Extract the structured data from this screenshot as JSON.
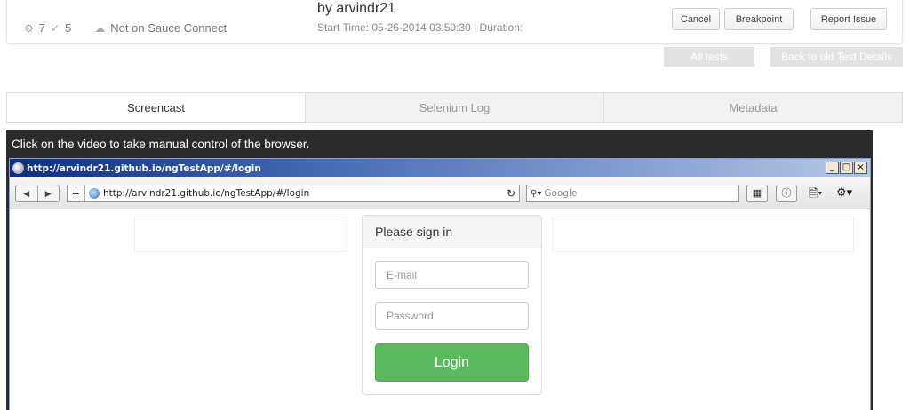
{
  "header": {
    "stats": {
      "builds_count": "7",
      "checks_count": "5",
      "tunnel_status": "Not on Sauce Connect"
    },
    "title": "by arvindr21",
    "start_time": "Start Time: 05-26-2014 03:59:30 | Duration:",
    "buttons": {
      "cancel": "Cancel",
      "breakpoint": "Breakpoint",
      "report": "Report Issue"
    },
    "links": {
      "all_tests": "All tests",
      "old_details": "Back to old Test Details"
    }
  },
  "tabs": [
    "Screencast",
    "Selenium Log",
    "Metadata"
  ],
  "video": {
    "caption": "Click on the video to take manual control of the browser.",
    "window_title": "http://arvindr21.github.io/ngTestApp/#/login",
    "url": "http://arvindr21.github.io/ngTestApp/#/login",
    "search_placeholder": "Google",
    "signin": {
      "heading": "Please sign in",
      "email_placeholder": "E-mail",
      "password_placeholder": "Password",
      "login_label": "Login"
    }
  },
  "colors": {
    "login_green": "#5cb85c",
    "video_bg": "#2b2b2b",
    "titlebar_blue": "#0b2e86"
  }
}
